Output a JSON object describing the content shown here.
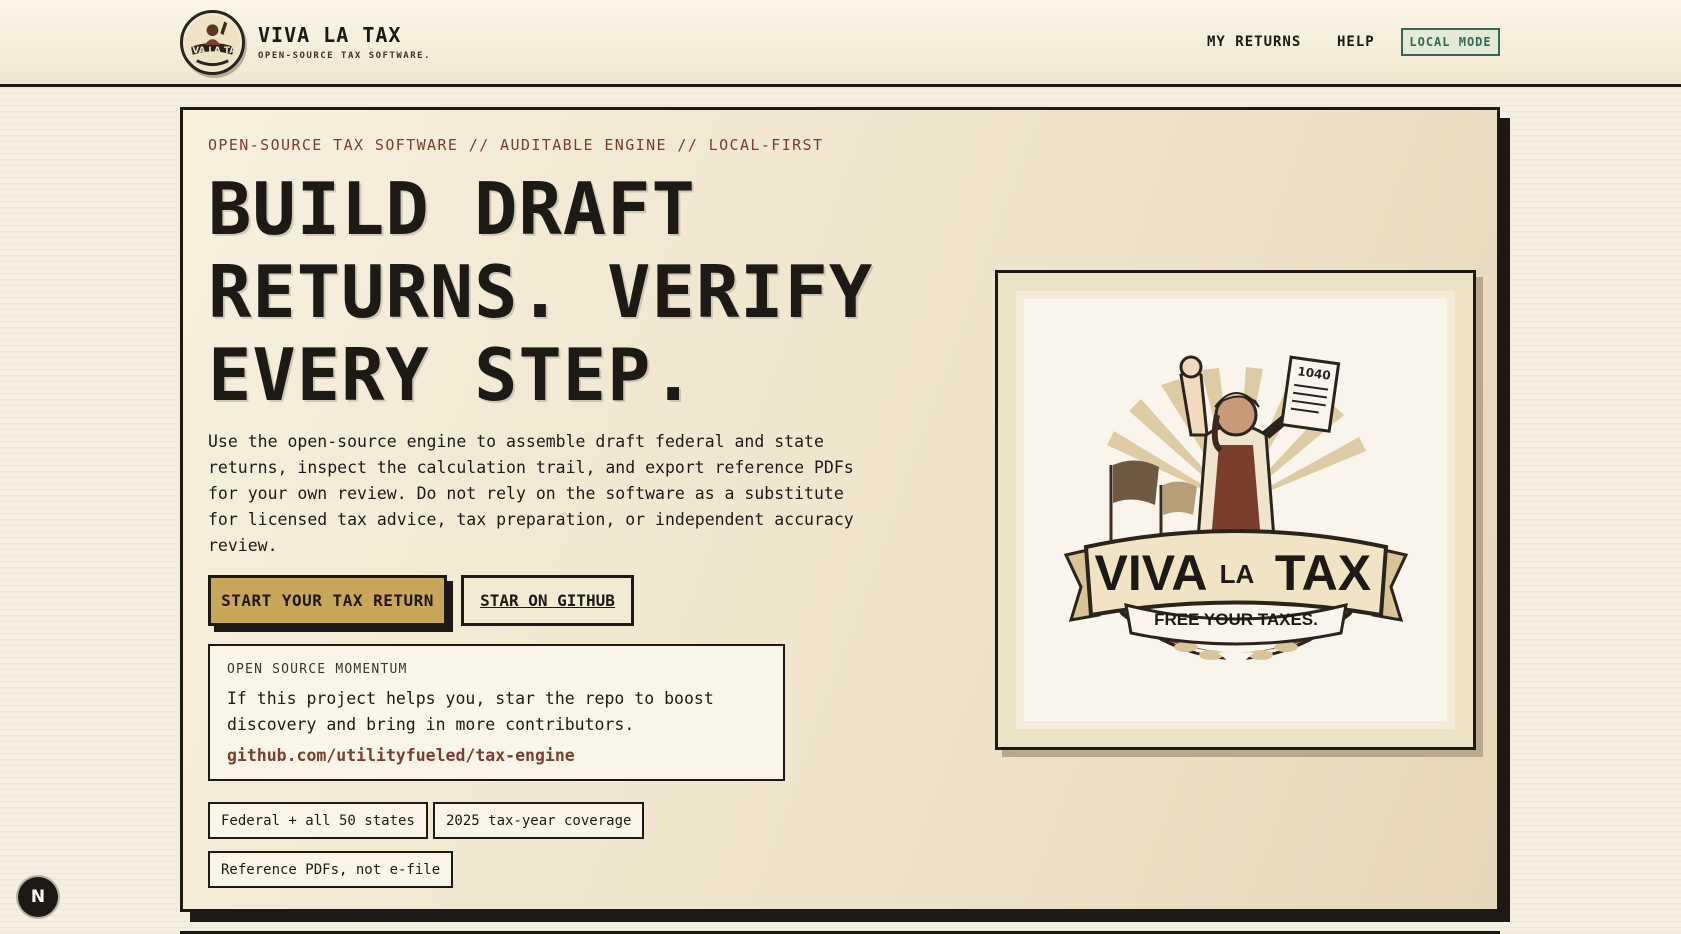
{
  "header": {
    "brand_name": "VIVA LA TAX",
    "brand_tagline": "OPEN-SOURCE TAX SOFTWARE.",
    "nav": {
      "my_returns": "MY RETURNS",
      "help": "HELP",
      "local_mode": "LOCAL MODE"
    }
  },
  "hero": {
    "kicker": "OPEN-SOURCE TAX SOFTWARE // AUDITABLE ENGINE // LOCAL-FIRST",
    "headline": "BUILD DRAFT RETURNS. VERIFY EVERY STEP.",
    "description": "Use the open-source engine to assemble draft federal and state returns, inspect the calculation trail, and export reference PDFs for your own review. Do not rely on the software as a substitute for licensed tax advice, tax preparation, or independent accuracy review.",
    "primary_button": "START YOUR TAX RETURN",
    "secondary_button": "STAR ON GITHUB",
    "momentum": {
      "label": "OPEN SOURCE MOMENTUM",
      "text": "If this project helps you, star the repo to boost discovery and bring in more contributors.",
      "link": "github.com/utilityfueled/tax-engine"
    },
    "chips": [
      "Federal + all 50 states",
      "2025 tax-year coverage",
      "Reference PDFs, not e-file"
    ]
  },
  "illustration": {
    "title_left": "VIVA",
    "title_mid": "LA",
    "title_right": "TAX",
    "banner": "FREE YOUR TAXES.",
    "form_label": "1040"
  },
  "dev_badge": "N",
  "colors": {
    "ink": "#1d1a16",
    "gold": "#c9a75a",
    "rust": "#7a3e2c",
    "green": "#2f6b56",
    "paper": "#f5efe2"
  }
}
